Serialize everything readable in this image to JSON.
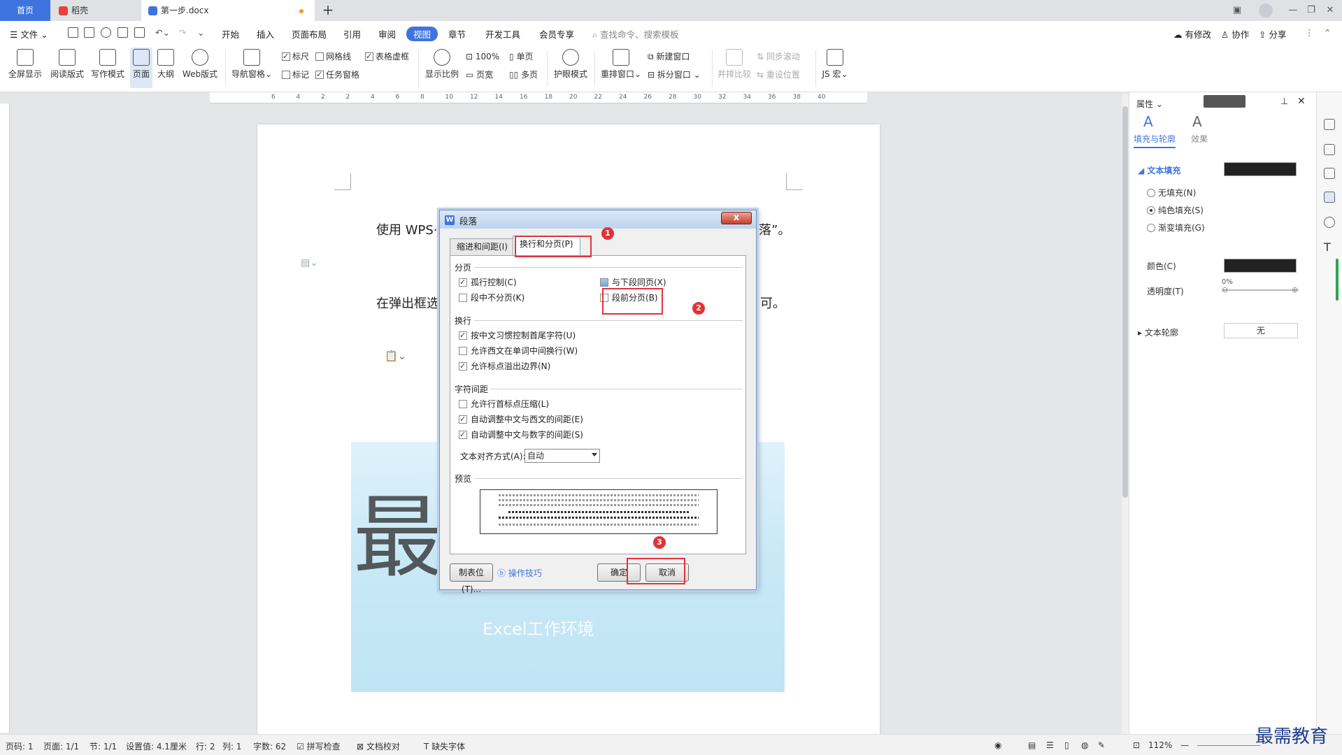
{
  "tabs": {
    "home": "首页",
    "draft": "稻壳",
    "doc": "第一步.docx"
  },
  "menu": {
    "file": "文件",
    "items": [
      "开始",
      "插入",
      "页面布局",
      "引用",
      "审阅",
      "视图",
      "章节",
      "开发工具",
      "会员专享"
    ],
    "search_placeholder": "查找命令、搜索模板",
    "right": [
      "有修改",
      "协作",
      "分享"
    ]
  },
  "ribbon": {
    "fullscreen": "全屏显示",
    "read_mode": "阅读版式",
    "write_mode": "写作模式",
    "page": "页面",
    "outline": "大纲",
    "web": "Web版式",
    "nav_pane": "导航窗格",
    "ruler": "标尺",
    "gridlines": "网格线",
    "table_grid": "表格虚框",
    "mark": "标记",
    "task_pane": "任务窗格",
    "zoom_ratio": "显示比例",
    "zoom_100": "100%",
    "single_page": "单页",
    "page_width": "页宽",
    "multi_page": "多页",
    "eye_mode": "护眼模式",
    "rearrange": "重排窗口",
    "new_window": "新建窗口",
    "split_window": "拆分窗口",
    "side_by_side": "并排比较",
    "sync_scroll": "同步滚动",
    "reset_pos": "重设位置",
    "js_macro": "JS 宏"
  },
  "ruler_ticks": [
    "6",
    "4",
    "2",
    "2",
    "4",
    "6",
    "8",
    "10",
    "12",
    "14",
    "16",
    "18",
    "20",
    "22",
    "24",
    "26",
    "28",
    "30",
    "32",
    "34",
    "36",
    "38",
    "40"
  ],
  "document": {
    "line1_start": "使用 WPS·",
    "line1_end": "落”。",
    "line2_start": "在弹出框选",
    "line2_end": "可。",
    "watermark": "最需教育",
    "watermark_sub": "Excel工作环境"
  },
  "dialog": {
    "title": "段落",
    "tab_indent": "缩进和间距(I)",
    "tab_breaks": "换行和分页(P)",
    "section_pagination": "分页",
    "widow_control": "孤行控制(C)",
    "keep_with_next": "与下段同页(X)",
    "keep_lines": "段中不分页(K)",
    "page_break_before": "段前分页(B)",
    "section_linebreak": "换行",
    "cjk_rules": "按中文习惯控制首尾字符(U)",
    "allow_western_break": "允许西文在单词中间换行(W)",
    "allow_punct_overflow": "允许标点溢出边界(N)",
    "section_spacing": "字符间距",
    "allow_punct_compress": "允许行首标点压缩(L)",
    "auto_cn_western": "自动调整中文与西文的间距(E)",
    "auto_cn_number": "自动调整中文与数字的间距(S)",
    "text_align_label": "文本对齐方式(A):",
    "text_align_value": "自动",
    "section_preview": "预览",
    "tabs_button": "制表位(T)...",
    "tips": "操作技巧",
    "ok": "确定",
    "cancel": "取消",
    "close_glyph": "x",
    "badges": [
      "1",
      "2",
      "3"
    ]
  },
  "panel": {
    "header": "属性",
    "tab_fill": "填充与轮廓",
    "tab_effect": "效果",
    "text_fill": "文本填充",
    "no_fill": "无填充(N)",
    "solid_fill": "纯色填充(S)",
    "gradient_fill": "渐变填充(G)",
    "color": "颜色(C)",
    "transparency": "透明度(T)",
    "transparency_value": "0%",
    "text_outline": "文本轮廓",
    "outline_value": "无"
  },
  "status": {
    "page_code": "页码: 1",
    "page": "页面: 1/1",
    "section": "节: 1/1",
    "setting": "设置值: 4.1厘米",
    "row": "行: 2",
    "col": "列: 1",
    "words": "字数: 62",
    "spell": "拼写检查",
    "proof": "文档校对",
    "missing_font": "缺失字体",
    "zoom": "112%"
  },
  "logo": "最需教育",
  "colors": {
    "accent": "#3f74e0",
    "highlight": "#e0333a"
  }
}
